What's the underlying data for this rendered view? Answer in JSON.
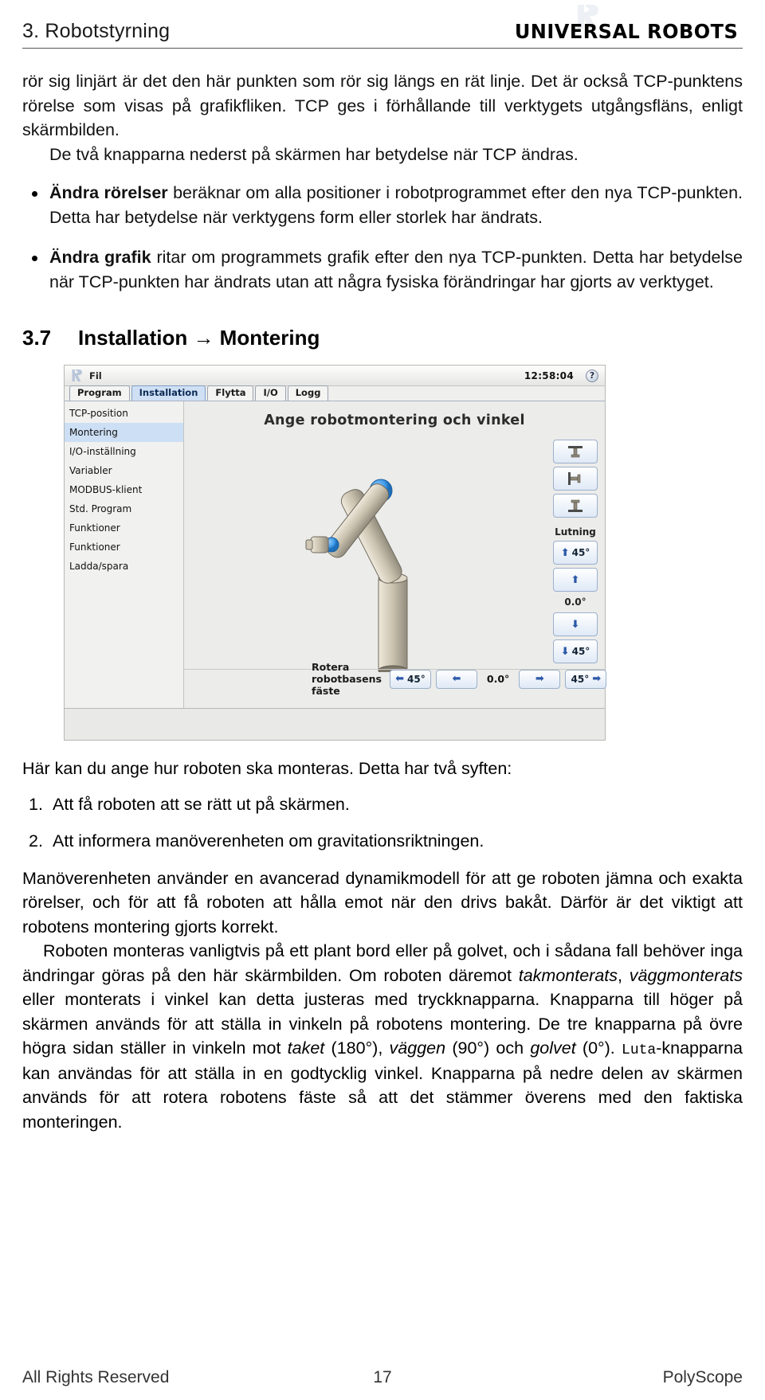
{
  "header": {
    "chapter": "3.  Robotstyrning",
    "brand": "UNIVERSAL ROBOTS",
    "logo_icon": "ur-logo-icon"
  },
  "body": {
    "para1": "rör sig linjärt är det den här punkten som rör sig längs en rät linje. Det är också TCP-punktens rörelse som visas på grafikfliken. TCP ges i förhållande till verktygets utgångsfläns, enligt skärmbilden.",
    "para2": "De två knapparna nederst på skärmen har betydelse när TCP ändras.",
    "bullets": [
      {
        "lead": "Ändra rörelser",
        "rest": " beräknar om alla positioner i robotprogrammet efter den nya TCP-punkten. Detta har betydelse när verktygens form eller storlek har ändrats."
      },
      {
        "lead": "Ändra grafik",
        "rest": " ritar om programmets grafik efter den nya TCP-punkten. Detta har betydelse när TCP-punkten har ändrats utan att några fysiska förändringar har gjorts av verktyget."
      }
    ]
  },
  "section": {
    "number": "3.7",
    "title": "Installation → Montering"
  },
  "screenshot": {
    "titlebar": {
      "logo_icon": "ur-logo-icon",
      "file_menu": "Fil",
      "clock": "12:58:04",
      "help_icon": "help-question-icon"
    },
    "tabs": [
      {
        "label": "Program",
        "active": false
      },
      {
        "label": "Installation",
        "active": true
      },
      {
        "label": "Flytta",
        "active": false
      },
      {
        "label": "I/O",
        "active": false
      },
      {
        "label": "Logg",
        "active": false
      }
    ],
    "sidebar": [
      {
        "label": "TCP-position",
        "selected": false
      },
      {
        "label": "Montering",
        "selected": true
      },
      {
        "label": "I/O-inställning",
        "selected": false
      },
      {
        "label": "Variabler",
        "selected": false
      },
      {
        "label": "MODBUS-klient",
        "selected": false
      },
      {
        "label": "Std. Program",
        "selected": false
      },
      {
        "label": "Funktioner",
        "selected": false
      },
      {
        "label": "Funktioner",
        "selected": false
      },
      {
        "label": "Ladda/spara",
        "selected": false
      }
    ],
    "canvas_title": "Ange robotmontering och vinkel",
    "preset_buttons": [
      {
        "name": "ceiling-mount-button",
        "glyph": "⌐"
      },
      {
        "name": "wall-mount-button",
        "glyph": "⌐"
      },
      {
        "name": "floor-mount-button",
        "glyph": "1"
      }
    ],
    "tilt": {
      "label": "Lutning",
      "up_button": "45°",
      "up_small_button": "",
      "value": "0.0°",
      "down_small_button": "",
      "down_button": "45°"
    },
    "rotate": {
      "label": "Rotera robotbasens fäste",
      "left45": "45°",
      "left_step": "",
      "value": "0.0°",
      "right_step": "",
      "right45": "45°"
    }
  },
  "lower": {
    "intro": "Här kan du ange hur roboten ska monteras. Detta har två syften:",
    "list": [
      {
        "num": "1.",
        "text": "Att få roboten att se rätt ut på skärmen."
      },
      {
        "num": "2.",
        "text": "Att informera manöverenheten om gravitationsriktningen."
      }
    ],
    "para_a": "Manöverenheten använder en avancerad dynamikmodell för att ge roboten jämna och exakta rörelser, och för att få roboten att hålla emot när den drivs bakåt. Därför är det viktigt att robotens montering gjorts korrekt.",
    "para_b_1": "Roboten monteras vanligtvis på ett plant bord eller på golvet, och i sådana fall behöver inga ändringar göras på den här skärmbilden. Om roboten däremot ",
    "para_b_i1": "takmonterats",
    "para_b_2": ", ",
    "para_b_i2": "väggmonterats",
    "para_b_3": " eller monterats i vinkel kan detta justeras med tryckknapparna. Knapparna till höger på skärmen används för att ställa in vinkeln på robotens montering. De tre knapparna på övre högra sidan ställer in vinkeln mot ",
    "para_b_i3": "taket",
    "para_b_4": " (180°), ",
    "para_b_i4": "väggen",
    "para_b_5": " (90°) och ",
    "para_b_i5": "golvet",
    "para_b_6": " (0°). ",
    "para_b_mono": "Luta",
    "para_b_7": "-knapparna kan användas för att ställa in en godtycklig vinkel. Knapparna på nedre delen av skärmen används för att rotera robotens fäste så att det stämmer överens med den faktiska monteringen."
  },
  "footer": {
    "left": "All Rights Reserved",
    "page": "17",
    "right": "PolyScope"
  }
}
